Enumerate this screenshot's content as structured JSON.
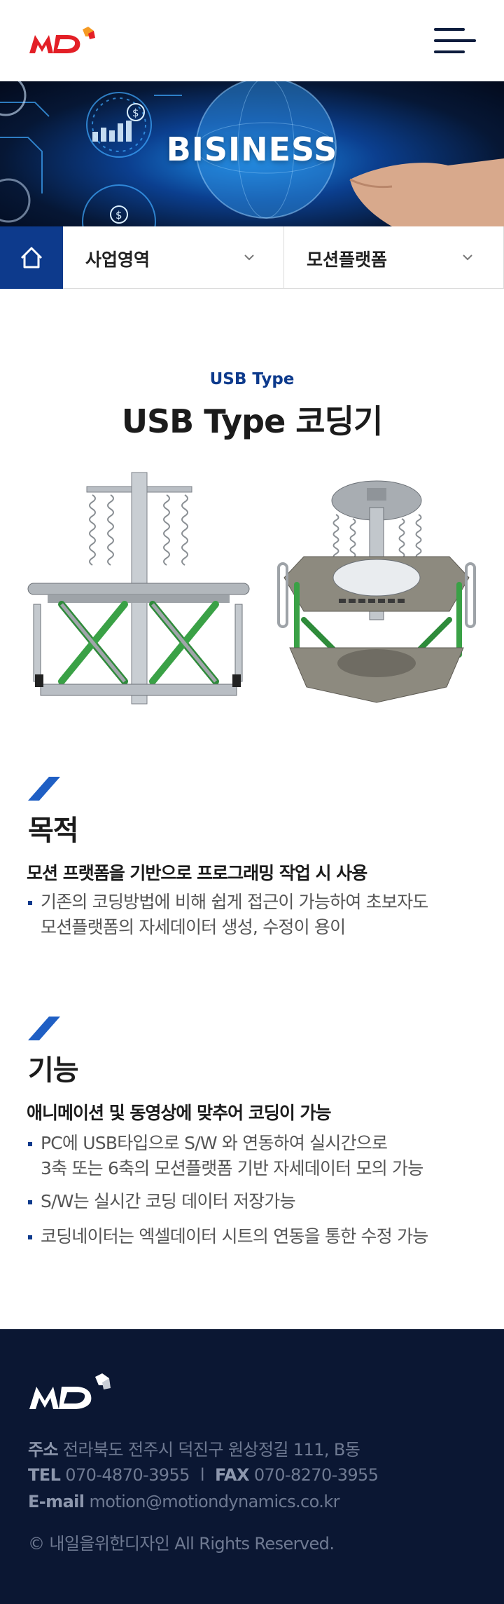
{
  "header": {
    "logo_text": "MD",
    "menu_icon": "hamburger-icon"
  },
  "banner": {
    "title": "BISINESS"
  },
  "breadcrumb": {
    "home_icon": "home-icon",
    "level1": "사업영역",
    "level2": "모션플랫폼"
  },
  "product": {
    "subtitle": "USB Type",
    "title": "USB Type 코딩기"
  },
  "purpose": {
    "heading": "목적",
    "lead": "모션 프랫폼을 기반으로 프로그래밍 작업 시 사용",
    "bullets": [
      {
        "line1": "기존의 코딩방법에 비해 쉽게 접근이 가능하여 초보자도",
        "line2": "모션플랫폼의 자세데이터 생성, 수정이 용이"
      }
    ]
  },
  "function": {
    "heading": "기능",
    "lead": "애니메이션 및 동영상에 맞추어 코딩이 가능",
    "bullets": [
      {
        "line1": "PC에 USB타입으로 S/W 와 연동하여 실시간으로",
        "line2": "3축 또는 6축의 모션플랫폼 기반 자세데이터 모의 가능"
      },
      {
        "line1": "S/W는 실시간 코딩 데이터 저장가능",
        "line2": ""
      },
      {
        "line1": "코딩네이터는 엑셀데이터 시트의 연동을 통한 수정 가능",
        "line2": ""
      }
    ]
  },
  "footer": {
    "address_label": "주소",
    "address": "전라북도 전주시 덕진구 원상정길 111, B동",
    "tel_label": "TEL",
    "tel": "070-4870-3955",
    "separator": "l",
    "fax_label": "FAX",
    "fax": "070-8270-3955",
    "email_label": "E-mail",
    "email": "motion@motiondynamics.co.kr",
    "copyright": "© 내일을위한디자인  All Rights Reserved."
  },
  "colors": {
    "brand_red": "#e31f26",
    "brand_orange": "#f59a23",
    "navy": "#0d3a8c",
    "footer_bg": "#0b1733"
  }
}
